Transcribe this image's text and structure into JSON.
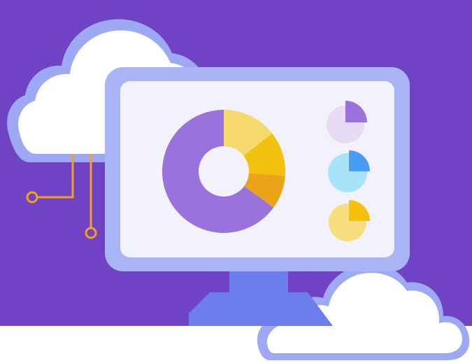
{
  "illustration": {
    "subject": "cloud analytics",
    "colors": {
      "background": "#6F43C3",
      "cloud_fill": "#FFFFFF",
      "cloud_shade": "#D6DCF7",
      "cloud_outline": "#9DA9F2",
      "monitor_frame": "#A8B4F5",
      "monitor_screen": "#F1F2FB",
      "monitor_stand": "#6B7EEB",
      "donut_purple": "#9A72DB",
      "donut_yellow_light": "#F6D96C",
      "donut_yellow": "#F3C20F",
      "donut_orange": "#EBA418",
      "pie_purple_bg": "#E6DCF4",
      "pie_blue_bg": "#A9E3FB",
      "pie_blue": "#4A9BF5",
      "pie_yellow_bg": "#F8DD7C",
      "pie_yellow": "#F3C20F",
      "connector": "#F1A21A"
    },
    "icons": [
      "cloud-icon",
      "monitor-icon",
      "donut-chart-icon",
      "pie-chart-icon",
      "circuit-connector-icon"
    ]
  }
}
